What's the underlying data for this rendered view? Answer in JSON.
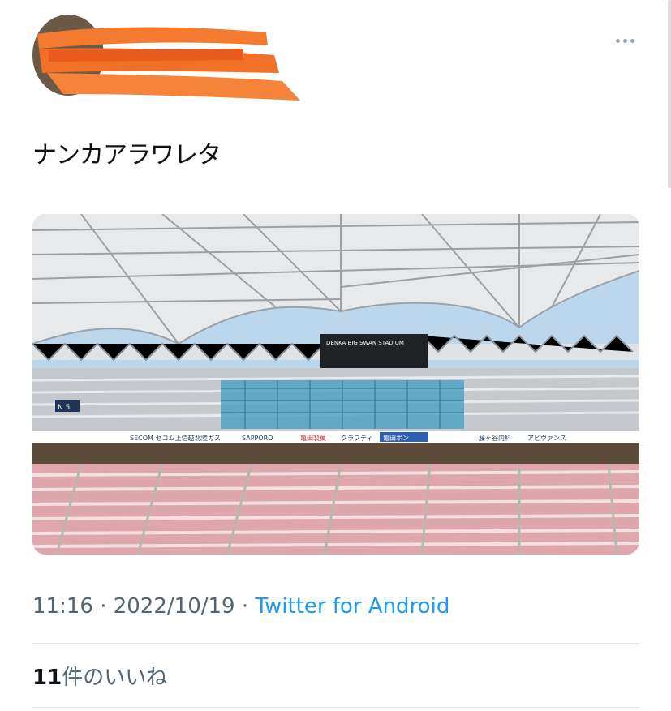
{
  "tweet": {
    "text": "ナンカアラワレタ",
    "timestamp": "11:16 · 2022/10/19 · ",
    "source": "Twitter for Android",
    "likes_count": "11",
    "likes_label": "件のいいね"
  },
  "photo": {
    "scoreboard_text": "DENKA BIG SWAN STADIUM",
    "ad_banners": [
      "SECOM セコム上信越",
      "北陸ガス",
      "SAPPORO",
      "亀田製菓",
      "クラフティ",
      "亀田ポン",
      "藤ヶ谷内科",
      "アビヴァンス"
    ],
    "board_label": "N 5"
  },
  "colors": {
    "accent": "#1d9bf0",
    "meta": "#536471",
    "scribble": "#f37021"
  },
  "icons": [
    "more-options-icon"
  ]
}
